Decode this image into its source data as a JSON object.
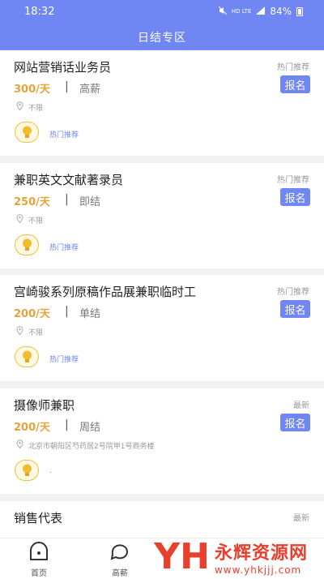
{
  "status_bar": {
    "time": "18:32",
    "network": "HD LTE",
    "battery": "84%"
  },
  "header": {
    "title": "日结专区"
  },
  "jobs": [
    {
      "title": "网站营销话业务员",
      "tag": "热门推荐",
      "salary": "300/天",
      "type": "高薪",
      "apply": "报名",
      "location": "不限",
      "hot": "热门推荐"
    },
    {
      "title": "兼职英文文献著录员",
      "tag": "热门推荐",
      "salary": "250/天",
      "type": "即结",
      "apply": "报名",
      "location": "不限",
      "hot": "热门推荐"
    },
    {
      "title": "宫崎骏系列原稿作品展兼职临时工",
      "tag": "热门推荐",
      "salary": "200/天",
      "type": "单结",
      "apply": "报名",
      "location": "不限",
      "hot": "热门推荐"
    },
    {
      "title": "摄像师兼职",
      "tag": "最新",
      "salary": "200/天",
      "type": "周结",
      "apply": "报名",
      "location": "北京市朝阳区芍药居2号院甲1号商务楼",
      "hot": "."
    },
    {
      "title": "销售代表",
      "tag": "最新"
    }
  ],
  "nav": [
    {
      "label": "首页",
      "icon": "home-icon"
    },
    {
      "label": "高薪",
      "icon": "chat-icon"
    }
  ],
  "watermark": {
    "main": "永辉资源网",
    "url": "www.yhkjjj.com"
  }
}
